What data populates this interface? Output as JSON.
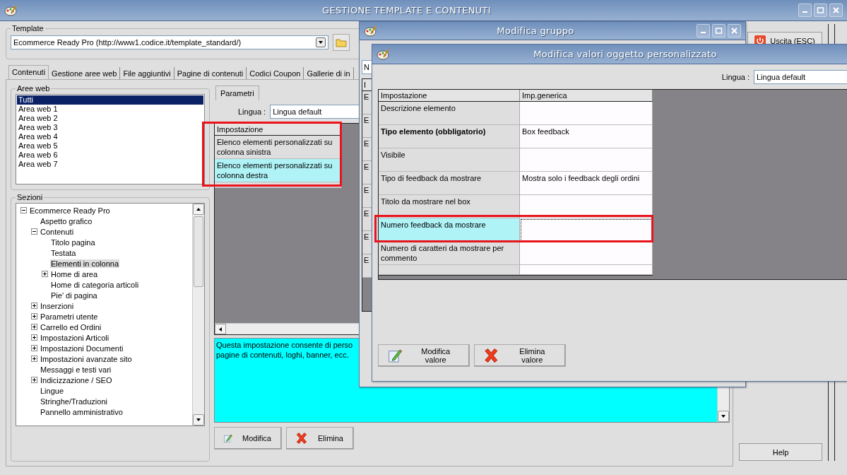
{
  "window": {
    "title": "GESTIONE TEMPLATE E CONTENUTI"
  },
  "template": {
    "label": "Template",
    "value": "Ecommerce Ready Pro (http://www1.codice.it/template_standard/)"
  },
  "tabs": [
    {
      "label": "Contenuti",
      "selected": true
    },
    {
      "label": "Gestione aree web",
      "selected": false
    },
    {
      "label": "File aggiuntivi",
      "selected": false
    },
    {
      "label": "Pagine di contenuti",
      "selected": false
    },
    {
      "label": "Codici Coupon",
      "selected": false
    },
    {
      "label": "Gallerie di in",
      "selected": false
    }
  ],
  "aree_web": {
    "label": "Aree web",
    "items": [
      {
        "label": "Tutti",
        "selected": true
      },
      {
        "label": "Area web 1",
        "selected": false
      },
      {
        "label": "Area web 2",
        "selected": false
      },
      {
        "label": "Area web 3",
        "selected": false
      },
      {
        "label": "Area web 4",
        "selected": false
      },
      {
        "label": "Area web 5",
        "selected": false
      },
      {
        "label": "Area web 6",
        "selected": false
      },
      {
        "label": "Area web 7",
        "selected": false
      }
    ]
  },
  "sezioni": {
    "label": "Sezioni",
    "tree": [
      {
        "label": "Ecommerce Ready Pro",
        "selected": false,
        "expanded": true,
        "children": [
          {
            "label": "Aspetto grafico",
            "selected": false
          },
          {
            "label": "Contenuti",
            "selected": false,
            "expanded": true,
            "children": [
              {
                "label": "Titolo pagina",
                "selected": false
              },
              {
                "label": "Testata",
                "selected": false
              },
              {
                "label": "Elementi in colonna",
                "selected": true
              },
              {
                "label": "Home di area",
                "selected": false,
                "expanded": false
              },
              {
                "label": "Home di categoria articoli",
                "selected": false
              },
              {
                "label": "Pie' di pagina",
                "selected": false
              }
            ]
          },
          {
            "label": "Inserzioni",
            "selected": false,
            "expanded": false
          },
          {
            "label": "Parametri utente",
            "selected": false,
            "expanded": false
          },
          {
            "label": "Carrello ed Ordini",
            "selected": false,
            "expanded": false
          },
          {
            "label": "Impostazioni Articoli",
            "selected": false,
            "expanded": false
          },
          {
            "label": "Impostazioni Documenti",
            "selected": false,
            "expanded": false
          },
          {
            "label": "Impostazioni avanzate sito",
            "selected": false,
            "expanded": false
          },
          {
            "label": "Messaggi e testi vari",
            "selected": false
          },
          {
            "label": "Indicizzazione / SEO",
            "selected": false,
            "expanded": false
          },
          {
            "label": "Lingue",
            "selected": false
          },
          {
            "label": "Stringhe/Traduzioni",
            "selected": false
          },
          {
            "label": "Pannello amministrativo",
            "selected": false
          }
        ]
      }
    ]
  },
  "parametri": {
    "tab": "Parametri",
    "lingua_label": "Lingua :",
    "lingua_value": "Lingua default",
    "annotated": true,
    "columns": [
      "Impostazione"
    ],
    "rows": [
      {
        "label": "Elenco elementi personalizzati su colonna sinistra",
        "selected": false
      },
      {
        "label": "Elenco elementi personalizzati su colonna destra",
        "selected": true
      }
    ],
    "description": "Questa impostazione consente di perso\npagine di contenuti, loghi, banner, ecc.",
    "buttons": [
      {
        "label": "Modifica",
        "kind": "edit"
      },
      {
        "label": "Elimina",
        "kind": "delete"
      }
    ]
  },
  "side_buttons": [
    {
      "label": "Uscita (ESC)",
      "kind": "exit"
    },
    {
      "label": "Help",
      "kind": "help"
    }
  ],
  "dialog_gruppo": {
    "title": "Modifica gruppo",
    "field_fragment": "N",
    "column_fragment": "I",
    "row_fragments": [
      "E",
      "E",
      "E",
      "E",
      "E",
      "E",
      "E",
      "E"
    ]
  },
  "dialog_valori": {
    "title": "Modifica valori oggetto personalizzato",
    "lingua_label": "Lingua :",
    "lingua_value": "Lingua default",
    "annotated": true,
    "columns": [
      "Impostazione",
      "Imp.generica"
    ],
    "rows": [
      {
        "label": "Descrizione elemento",
        "required": false,
        "selected": false
      },
      {
        "label": "Tipo elemento (obbligatorio)",
        "value": "Box feedback",
        "required": true,
        "selected": false
      },
      {
        "label": "Visibile",
        "required": false,
        "selected": false
      },
      {
        "label": "Tipo di feedback da mostrare",
        "value": "Mostra solo i feedback degli ordini",
        "required": false,
        "selected": false
      },
      {
        "label": "Titolo da mostrare nel box",
        "required": false,
        "selected": false
      },
      {
        "label": "Numero feedback da mostrare",
        "required": false,
        "selected": true
      },
      {
        "label": "Numero di caratteri da mostrare per commento",
        "required": false,
        "selected": false
      }
    ],
    "buttons": [
      {
        "label": "Modifica valore",
        "kind": "edit"
      },
      {
        "label": "Elimina valore",
        "kind": "delete"
      }
    ]
  }
}
